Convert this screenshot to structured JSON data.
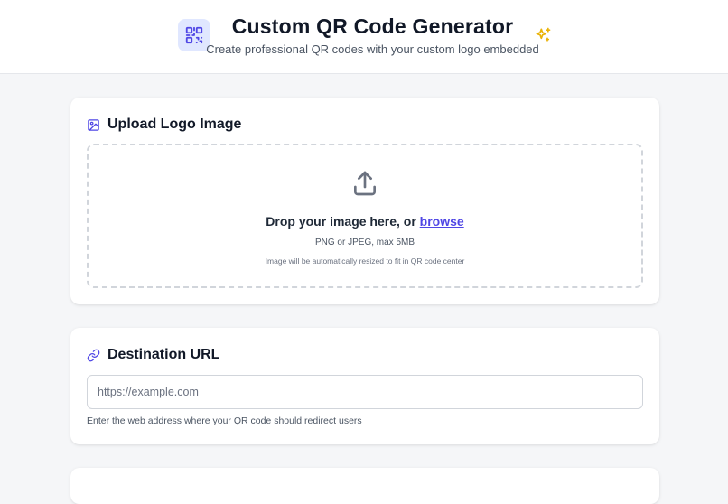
{
  "header": {
    "title": "Custom QR Code Generator",
    "subtitle": "Create professional QR codes with your custom logo embedded",
    "logo_icon": "qr-code-icon",
    "decor_icon": "sparkles-icon",
    "accent_color": "#4f46e5",
    "sparkle_color": "#eab308"
  },
  "upload": {
    "title": "Upload Logo Image",
    "icon": "image-icon",
    "drop_text": "Drop your image here, or",
    "browse_label": "browse",
    "format_text": "PNG or JPEG, max 5MB",
    "resize_text": "Image will be automatically resized to fit in QR code center"
  },
  "url": {
    "title": "Destination URL",
    "icon": "link-icon",
    "placeholder": "https://example.com",
    "value": "",
    "helper": "Enter the web address where your QR code should redirect users"
  }
}
